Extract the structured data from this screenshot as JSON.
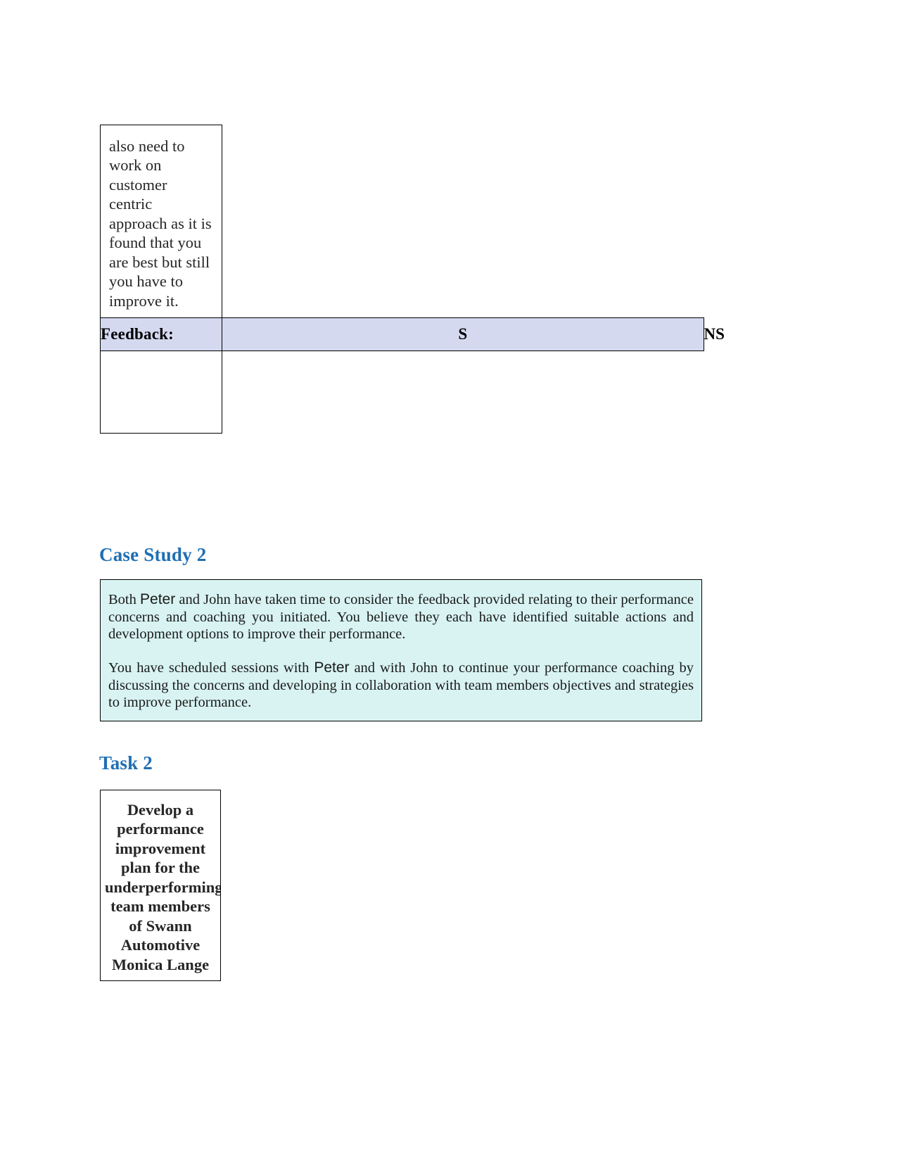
{
  "document": {
    "top_table": {
      "continued_cell_text": "also need to work on customer centric approach as it is found that you are best but still you have to improve it.",
      "feedback": {
        "label": "Feedback:",
        "satisfactory_mark": "S",
        "not_satisfactory_mark": "NS",
        "satisfactory_value": "",
        "not_satisfactory_value": ""
      }
    },
    "case_study": {
      "heading": "Case Study 2",
      "paragraph_1_part_1": "Both ",
      "paragraph_1_name": "Peter",
      "paragraph_1_part_2": " and John have taken time to consider the feedback provided relating to their performance concerns and coaching you initiated. You believe they each have identified suitable actions and development options to improve their performance.",
      "paragraph_2_part_1": "You have scheduled sessions with ",
      "paragraph_2_name": "Peter",
      "paragraph_2_part_2": " and with John to continue your performance coaching by discussing the concerns and developing in collaboration with team members objectives and strategies to improve performance."
    },
    "task": {
      "heading": "Task 2",
      "cell_text": "Develop a performance improvement plan for the underperforming team members of Swann Automotive Monica Lange"
    }
  },
  "colors": {
    "heading_blue": "#1f6fb2",
    "feedback_band": "#d5d9f0",
    "case_box_fill": "#d8f3f2",
    "border": "#000000",
    "body_text": "#262626"
  }
}
